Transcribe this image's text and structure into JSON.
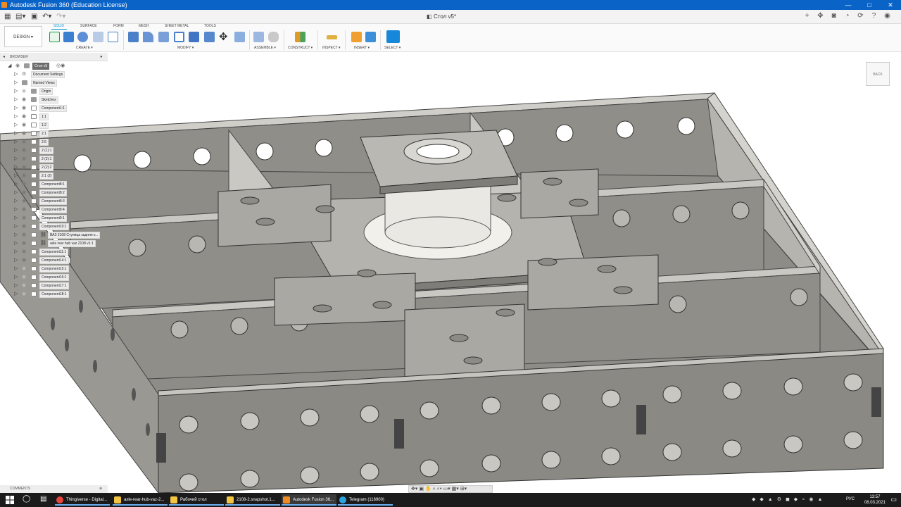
{
  "window": {
    "title": "Autodesk Fusion 360 (Education License)",
    "min": "—",
    "max": "□",
    "close": "✕"
  },
  "quickaccess": {
    "document_title": "Стол v5*"
  },
  "ribbon": {
    "design_label": "DESIGN ▾",
    "tabs": [
      "SOLID",
      "SURFACE",
      "FORM",
      "MESH",
      "SHEET METAL",
      "TOOLS"
    ],
    "groups": [
      "CREATE ▾",
      "MODIFY ▾",
      "ASSEMBLE ▾",
      "CONSTRUCT ▾",
      "INSPECT ▾",
      "INSERT ▾",
      "SELECT ▾"
    ]
  },
  "browser": {
    "header": "BROWSER",
    "root": "Стол v5",
    "items": [
      "Document Settings",
      "Named Views",
      "Origin",
      "Sketches",
      "Component1:1",
      "1:1",
      "1:2",
      "2:1",
      "2:5",
      "2 (1):1",
      "2 (2):1",
      "2 (2):2",
      "2:1 (2)",
      "Component8:1",
      "Component8:2",
      "Component8:3",
      "Component8:4",
      "Component9:1",
      "Component10:1",
      "ВАЗ 2108 Ступица задняя v...",
      "axle rear hub vaz 2108 v1:1",
      "Component11:1",
      "Component14:1",
      "Component15:1",
      "Component16:1",
      "Component17:1",
      "Component18:1"
    ]
  },
  "comments": {
    "label": "COMMENTS"
  },
  "viewcube": {
    "label": "BACK"
  },
  "taskbar": {
    "items": [
      {
        "label": "Thingiverse - Digital...",
        "color": "#e8453c"
      },
      {
        "label": "axle-rear-hub-vaz-2...",
        "color": "#f4c542"
      },
      {
        "label": "Рабочий стол",
        "color": "#f4c542"
      },
      {
        "label": "2108-2.snapshot.1...",
        "color": "#f4c542"
      },
      {
        "label": "Autodesk Fusion 36...",
        "color": "#f08a24"
      },
      {
        "label": "Telegram (116900)",
        "color": "#2aa3e0"
      }
    ],
    "lang": "РУС",
    "time": "13:57",
    "date": "08.03.2021"
  }
}
